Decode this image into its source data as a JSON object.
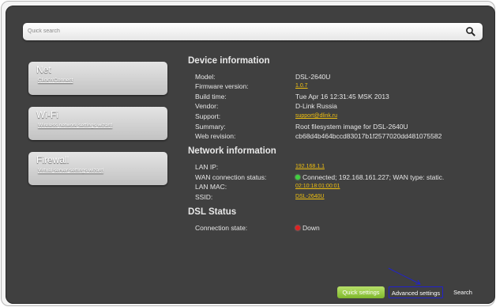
{
  "search": {
    "placeholder": "Quick search"
  },
  "cards": [
    {
      "title": "Net",
      "link": "Click'n'Connect"
    },
    {
      "title": "Wi-Fi",
      "link": "Wireless network settings wizard"
    },
    {
      "title": "Firewall",
      "link": "Virtual server settings wizard"
    }
  ],
  "device": {
    "title": "Device information",
    "rows": [
      {
        "label": "Model:",
        "value": "DSL-2640U"
      },
      {
        "label": "Firmware version:",
        "value": "1.0.7"
      },
      {
        "label": "Build time:",
        "value": "Tue Apr 16 12:31:45 MSK 2013"
      },
      {
        "label": "Vendor:",
        "value": "D-Link Russia"
      },
      {
        "label": "Support:",
        "value": "support@dlink.ru"
      },
      {
        "label": "Summary:",
        "value": "Root filesystem image for DSL-2640U"
      },
      {
        "label": "Web revision:",
        "value": "cb68d4b464bccd83017b1f2577020dd481075582"
      }
    ]
  },
  "network": {
    "title": "Network information",
    "rows": [
      {
        "label": "LAN IP:",
        "value": "192.168.1.1"
      },
      {
        "label": "WAN connection status:",
        "value": "Connected; 192.168.161.227; WAN type: static."
      },
      {
        "label": "LAN MAC:",
        "value": "02:10:18:01:00:01"
      },
      {
        "label": "SSID:",
        "value": "DSL-2640U"
      }
    ]
  },
  "dsl": {
    "title": "DSL Status",
    "rows": [
      {
        "label": "Connection state:",
        "value": "Down"
      }
    ]
  },
  "buttons": {
    "quick": "Quick settings",
    "advanced": "Advanced settings",
    "search": "Search"
  },
  "colors": {
    "panel": "#404040",
    "link": "#f0c010",
    "status_ok": "#3fcf3f",
    "status_down": "#e02020",
    "quick_button": "#8cc63f"
  }
}
